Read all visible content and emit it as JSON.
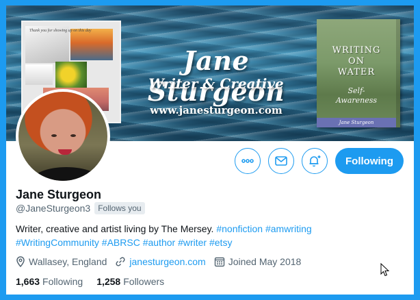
{
  "banner": {
    "title": "Jane Sturgeon",
    "subtitle": "Writer & Creative",
    "url": "www.janesturgeon.com",
    "collage_caption": "Thank you for showing up on this day",
    "book": {
      "title_line1": "WRITING",
      "title_line2": "ON",
      "title_line3": "WATER",
      "subtitle_line1": "Self-",
      "subtitle_line2": "Awareness",
      "author": "Jane Sturgeon"
    }
  },
  "actions": {
    "more_icon": "more-dots-icon",
    "message_icon": "envelope-icon",
    "notify_icon": "bell-plus-icon",
    "follow_label": "Following"
  },
  "profile": {
    "name": "Jane Sturgeon",
    "handle": "@JaneSturgeon3",
    "follows_you": "Follows you",
    "bio_text": "Writer, creative and artist living by The Mersey.",
    "bio_hashtags_line1": [
      "#nonfiction",
      "#amwriting"
    ],
    "bio_hashtags_line2": [
      "#WritingCommunity",
      "#ABRSC",
      "#author",
      "#writer",
      "#etsy"
    ],
    "location": "Wallasey, England",
    "website": "janesturgeon.com",
    "joined": "Joined May 2018",
    "following_count": "1,663",
    "following_label": "Following",
    "followers_count": "1,258",
    "followers_label": "Followers"
  },
  "colors": {
    "accent": "#1d9bf0",
    "page_bg": "#1d9bf0",
    "text_primary": "#0f1419",
    "text_secondary": "#536471"
  }
}
